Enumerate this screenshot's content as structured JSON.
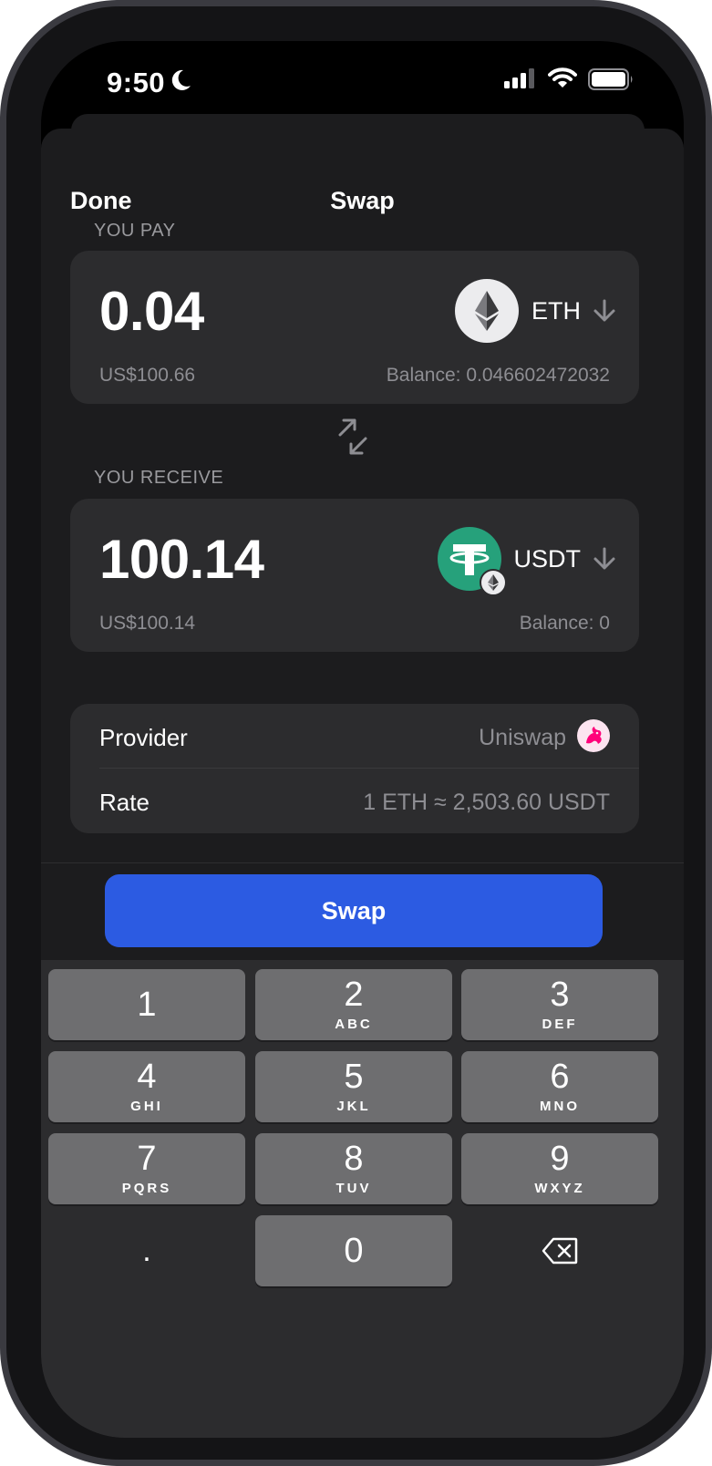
{
  "status_bar": {
    "time": "9:50",
    "icons": [
      "moon-icon",
      "signal-icon",
      "wifi-icon",
      "battery-icon"
    ]
  },
  "nav": {
    "done_label": "Done",
    "title": "Swap"
  },
  "pay": {
    "label": "YOU PAY",
    "amount": "0.04",
    "fiat": "US$100.66",
    "token": "ETH",
    "balance": "Balance: 0.046602472032"
  },
  "receive": {
    "label": "YOU RECEIVE",
    "amount": "100.14",
    "fiat": "US$100.14",
    "token": "USDT",
    "balance": "Balance: 0"
  },
  "details": {
    "provider_label": "Provider",
    "provider_value": "Uniswap",
    "rate_label": "Rate",
    "rate_value": "1 ETH ≈ 2,503.60 USDT"
  },
  "swap_button_label": "Swap",
  "keypad": [
    {
      "num": "1",
      "letters": ""
    },
    {
      "num": "2",
      "letters": "ABC"
    },
    {
      "num": "3",
      "letters": "DEF"
    },
    {
      "num": "4",
      "letters": "GHI"
    },
    {
      "num": "5",
      "letters": "JKL"
    },
    {
      "num": "6",
      "letters": "MNO"
    },
    {
      "num": "7",
      "letters": "PQRS"
    },
    {
      "num": "8",
      "letters": "TUV"
    },
    {
      "num": "9",
      "letters": "WXYZ"
    },
    {
      "num": "0",
      "letters": ""
    }
  ],
  "keypad_dot": ".",
  "colors": {
    "accent": "#2c5be2",
    "card": "#2c2c2e",
    "sheet": "#1c1c1e",
    "usdt": "#26a17b"
  }
}
